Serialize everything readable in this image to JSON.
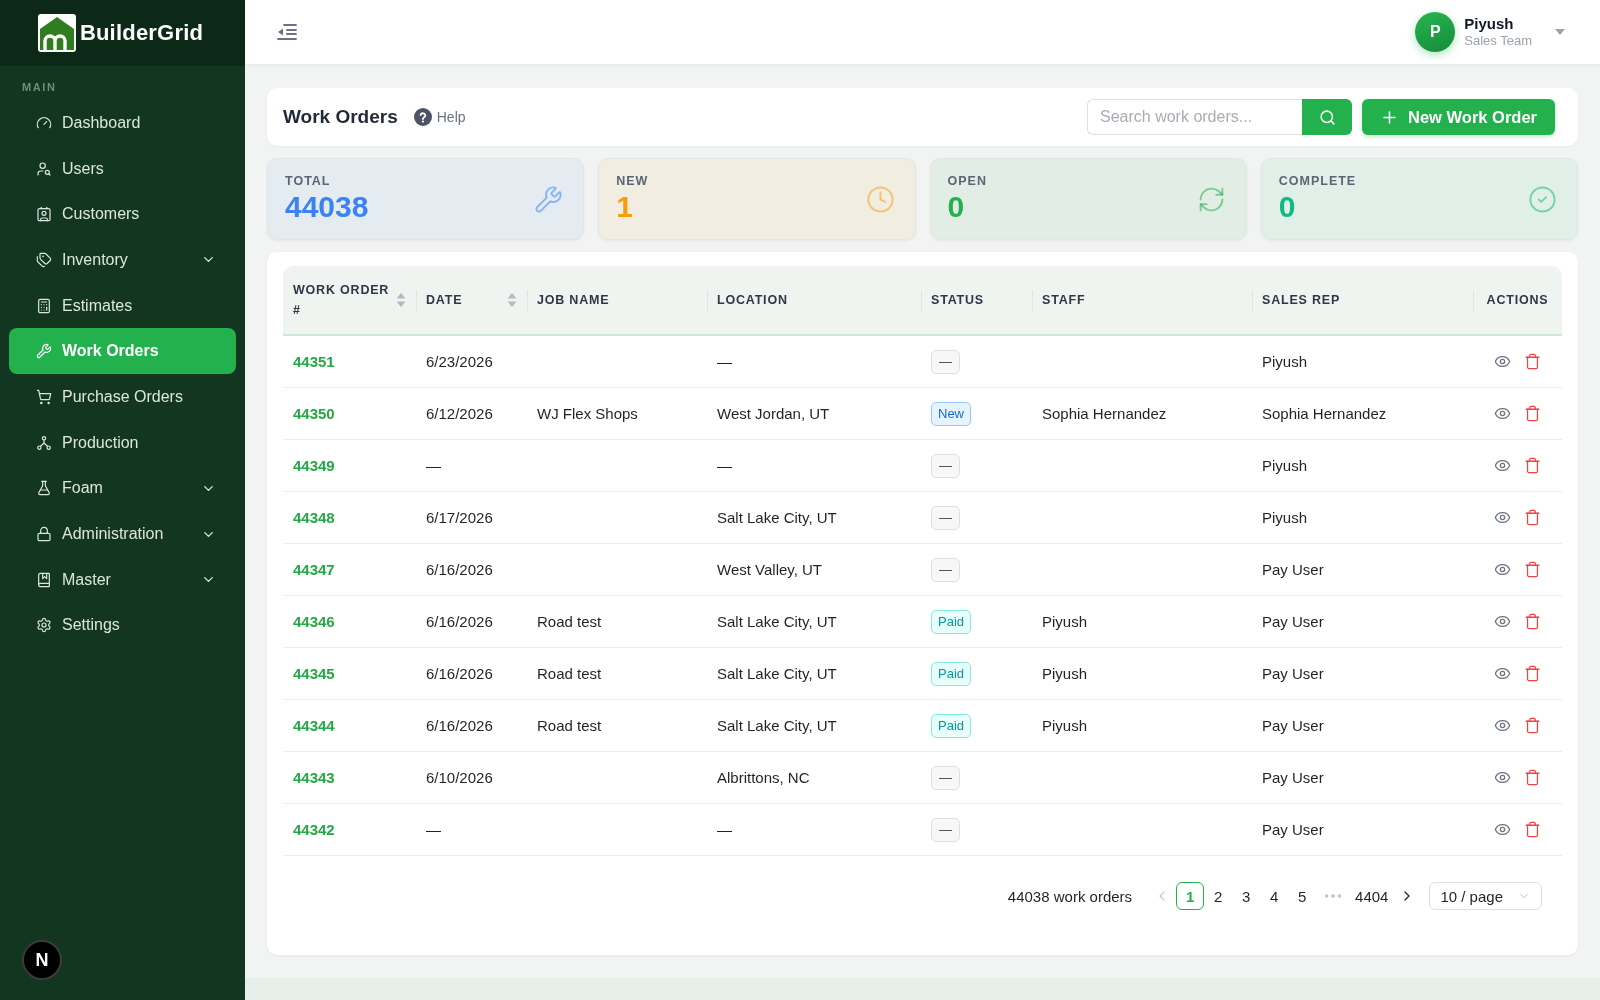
{
  "sidebar": {
    "brand": "BuilderGrid",
    "section": "MAIN",
    "items": [
      {
        "label": "Dashboard",
        "submenu": false,
        "selected": false
      },
      {
        "label": "Users",
        "submenu": false,
        "selected": false
      },
      {
        "label": "Customers",
        "submenu": false,
        "selected": false
      },
      {
        "label": "Inventory",
        "submenu": true,
        "selected": false
      },
      {
        "label": "Estimates",
        "submenu": false,
        "selected": false
      },
      {
        "label": "Work Orders",
        "submenu": false,
        "selected": true
      },
      {
        "label": "Purchase Orders",
        "submenu": false,
        "selected": false
      },
      {
        "label": "Production",
        "submenu": false,
        "selected": false
      },
      {
        "label": "Foam",
        "submenu": true,
        "selected": false
      },
      {
        "label": "Administration",
        "submenu": true,
        "selected": false
      },
      {
        "label": "Master",
        "submenu": true,
        "selected": false
      },
      {
        "label": "Settings",
        "submenu": false,
        "selected": false
      }
    ],
    "dev_indicator": "N"
  },
  "topbar": {
    "user": {
      "initial": "P",
      "name": "Piyush",
      "role": "Sales Team"
    }
  },
  "page_header": {
    "title": "Work Orders",
    "help": "Help",
    "search": {
      "placeholder": "Search work orders..."
    },
    "new_button": "New Work Order"
  },
  "stats": [
    {
      "label": "TOTAL",
      "value": "44038",
      "color": "#3b82f6"
    },
    {
      "label": "NEW",
      "value": "1",
      "color": "#f59e0b"
    },
    {
      "label": "OPEN",
      "value": "0",
      "color": "#22b14c"
    },
    {
      "label": "COMPLETE",
      "value": "0",
      "color": "#10b981"
    }
  ],
  "table": {
    "columns": [
      {
        "label": "WORK ORDER #",
        "sortable": true
      },
      {
        "label": "DATE",
        "sortable": true
      },
      {
        "label": "JOB NAME",
        "sortable": false
      },
      {
        "label": "LOCATION",
        "sortable": false
      },
      {
        "label": "STATUS",
        "sortable": false
      },
      {
        "label": "STAFF",
        "sortable": false
      },
      {
        "label": "SALES REP",
        "sortable": false
      },
      {
        "label": "ACTIONS",
        "sortable": false
      }
    ],
    "rows": [
      {
        "work_order": "44351",
        "date": "6/23/2026",
        "location": "—",
        "status": {
          "kind": "none",
          "label": "—"
        },
        "sales_rep": "Piyush"
      },
      {
        "work_order": "44350",
        "date": "6/12/2026",
        "job_name": "WJ Flex Shops",
        "location": "West Jordan, UT",
        "status": {
          "kind": "new",
          "label": "New"
        },
        "staff": "Sophia Hernandez",
        "sales_rep": "Sophia Hernandez"
      },
      {
        "work_order": "44349",
        "date": "—",
        "location": "—",
        "status": {
          "kind": "none",
          "label": "—"
        },
        "sales_rep": "Piyush"
      },
      {
        "work_order": "44348",
        "date": "6/17/2026",
        "location": "Salt Lake City, UT",
        "status": {
          "kind": "none",
          "label": "—"
        },
        "sales_rep": "Piyush"
      },
      {
        "work_order": "44347",
        "date": "6/16/2026",
        "location": "West Valley, UT",
        "status": {
          "kind": "none",
          "label": "—"
        },
        "sales_rep": "Pay User"
      },
      {
        "work_order": "44346",
        "date": "6/16/2026",
        "job_name": "Road test",
        "location": "Salt Lake City, UT",
        "status": {
          "kind": "paid",
          "label": "Paid"
        },
        "staff": "Piyush",
        "sales_rep": "Pay User"
      },
      {
        "work_order": "44345",
        "date": "6/16/2026",
        "job_name": "Road test",
        "location": "Salt Lake City, UT",
        "status": {
          "kind": "paid",
          "label": "Paid"
        },
        "staff": "Piyush",
        "sales_rep": "Pay User"
      },
      {
        "work_order": "44344",
        "date": "6/16/2026",
        "job_name": "Road test",
        "location": "Salt Lake City, UT",
        "status": {
          "kind": "paid",
          "label": "Paid"
        },
        "staff": "Piyush",
        "sales_rep": "Pay User"
      },
      {
        "work_order": "44343",
        "date": "6/10/2026",
        "location": "Albrittons, NC",
        "status": {
          "kind": "none",
          "label": "—"
        },
        "sales_rep": "Pay User"
      },
      {
        "work_order": "44342",
        "date": "—",
        "location": "—",
        "status": {
          "kind": "none",
          "label": "—"
        },
        "sales_rep": "Pay User"
      }
    ]
  },
  "pagination": {
    "summary": "44038 work orders",
    "prev": {
      "disabled": true
    },
    "next": {
      "disabled": false
    },
    "pages": [
      {
        "kind": "page",
        "label": "1",
        "selected": true
      },
      {
        "kind": "page",
        "label": "2",
        "selected": false
      },
      {
        "kind": "page",
        "label": "3",
        "selected": false
      },
      {
        "kind": "page",
        "label": "4",
        "selected": false
      },
      {
        "kind": "page",
        "label": "5",
        "selected": false
      },
      {
        "kind": "ellipsis"
      },
      {
        "kind": "page",
        "label": "4404",
        "selected": false
      }
    ],
    "page_size": "10 / page"
  }
}
